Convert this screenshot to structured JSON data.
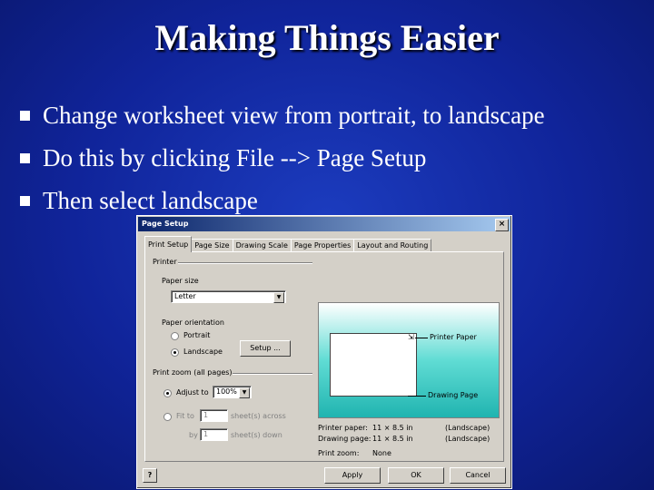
{
  "slide": {
    "title": "Making Things Easier",
    "bullets": [
      "Change worksheet view from portrait, to landscape",
      "Do this by clicking File --> Page Setup",
      "Then select landscape"
    ]
  },
  "dialog": {
    "title": "Page Setup",
    "close": "×",
    "tabs": [
      "Print Setup",
      "Page Size",
      "Drawing Scale",
      "Page Properties",
      "Layout and Routing"
    ],
    "printer_group": "Printer",
    "paper_size_label": "Paper size",
    "paper_size_value": "Letter",
    "orientation_label": "Paper orientation",
    "portrait": "Portrait",
    "landscape": "Landscape",
    "setup_button": "Setup ...",
    "zoom_group": "Print zoom (all pages)",
    "adjust_label": "Adjust to",
    "adjust_value": "100%",
    "fit_label": "Fit to",
    "fit_across_value": "1",
    "fit_across_label": "sheet(s) across",
    "by_label": "by",
    "fit_down_value": "1",
    "fit_down_label": "sheet(s) down",
    "preview_printer_paper": "Printer Paper",
    "preview_drawing_page": "Drawing Page",
    "info_printer_paper_label": "Printer paper:",
    "info_printer_paper_value": "11 × 8.5 in",
    "info_printer_paper_orient": "(Landscape)",
    "info_drawing_page_label": "Drawing page:",
    "info_drawing_page_value": "11 × 8.5 in",
    "info_drawing_page_orient": "(Landscape)",
    "info_print_zoom_label": "Print zoom:",
    "info_print_zoom_value": "None",
    "help_icon": "?",
    "apply_button": "Apply",
    "ok_button": "OK",
    "cancel_button": "Cancel"
  }
}
